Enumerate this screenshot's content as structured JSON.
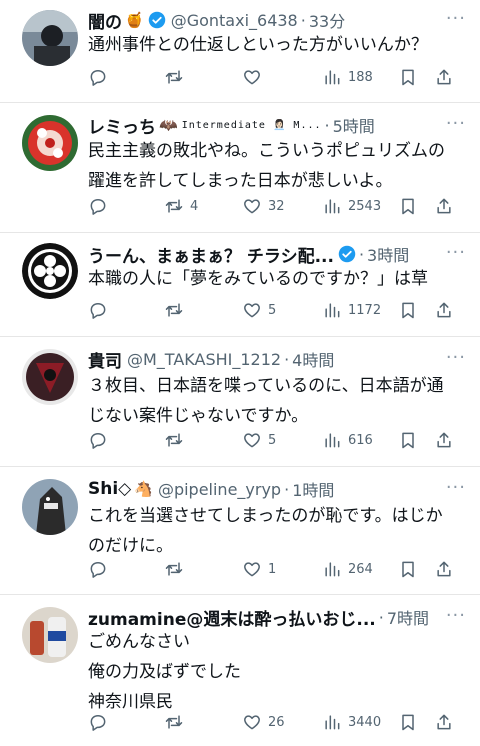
{
  "tweets": [
    {
      "name": "闇の",
      "name_emoji": "🍯",
      "handle": "@Gontaxi_6438",
      "time": "33分",
      "verified": true,
      "badge": "",
      "text": [
        "通州事件との仕返しといった方がいいんか？"
      ],
      "reply": "",
      "retweet": "",
      "like": "",
      "views": "188"
    },
    {
      "name": "レミっち",
      "name_emoji": "🦇",
      "handle": "",
      "time": "5時間",
      "verified": false,
      "badge": "Intermediate 👩🏻‍💼 M...",
      "text": [
        "民主主義の敗北やね。こういうポピュリズムの",
        "躍進を許してしまった日本が悲しいよ。"
      ],
      "reply": "",
      "retweet": "4",
      "like": "32",
      "views": "2543"
    },
    {
      "name": "うーん、まぁまぁ？ チラシ配...",
      "name_emoji": "",
      "handle": "",
      "time": "3時間",
      "verified": true,
      "badge": "",
      "text": [
        "本職の人に「夢をみているのですか？」は草"
      ],
      "reply": "",
      "retweet": "",
      "like": "5",
      "views": "1172"
    },
    {
      "name": "貴司",
      "name_emoji": "",
      "handle": "@M_TAKASHI_1212",
      "time": "4時間",
      "verified": false,
      "badge": "",
      "text": [
        "３枚目、日本語を喋っているのに、日本語が通",
        "じない案件じゃないですか。"
      ],
      "reply": "",
      "retweet": "",
      "like": "5",
      "views": "616"
    },
    {
      "name": "Shi◇",
      "name_emoji": "🐴",
      "handle": "@pipeline_yryp",
      "time": "1時間",
      "verified": false,
      "badge": "",
      "text": [
        "これを当選させてしまったのが恥です。はじか",
        "のだけに。"
      ],
      "reply": "",
      "retweet": "",
      "like": "1",
      "views": "264"
    },
    {
      "name": "zumamine@週末は酔っ払いおじ...",
      "name_emoji": "",
      "handle": "",
      "time": "7時間",
      "verified": false,
      "badge": "",
      "text": [
        "ごめんなさい",
        "俺の力及ばずでした",
        "神奈川県民"
      ],
      "reply": "",
      "retweet": "",
      "like": "26",
      "views": "3440"
    }
  ],
  "colors": {
    "verified": "#1d9bf0",
    "muted": "#536471"
  }
}
